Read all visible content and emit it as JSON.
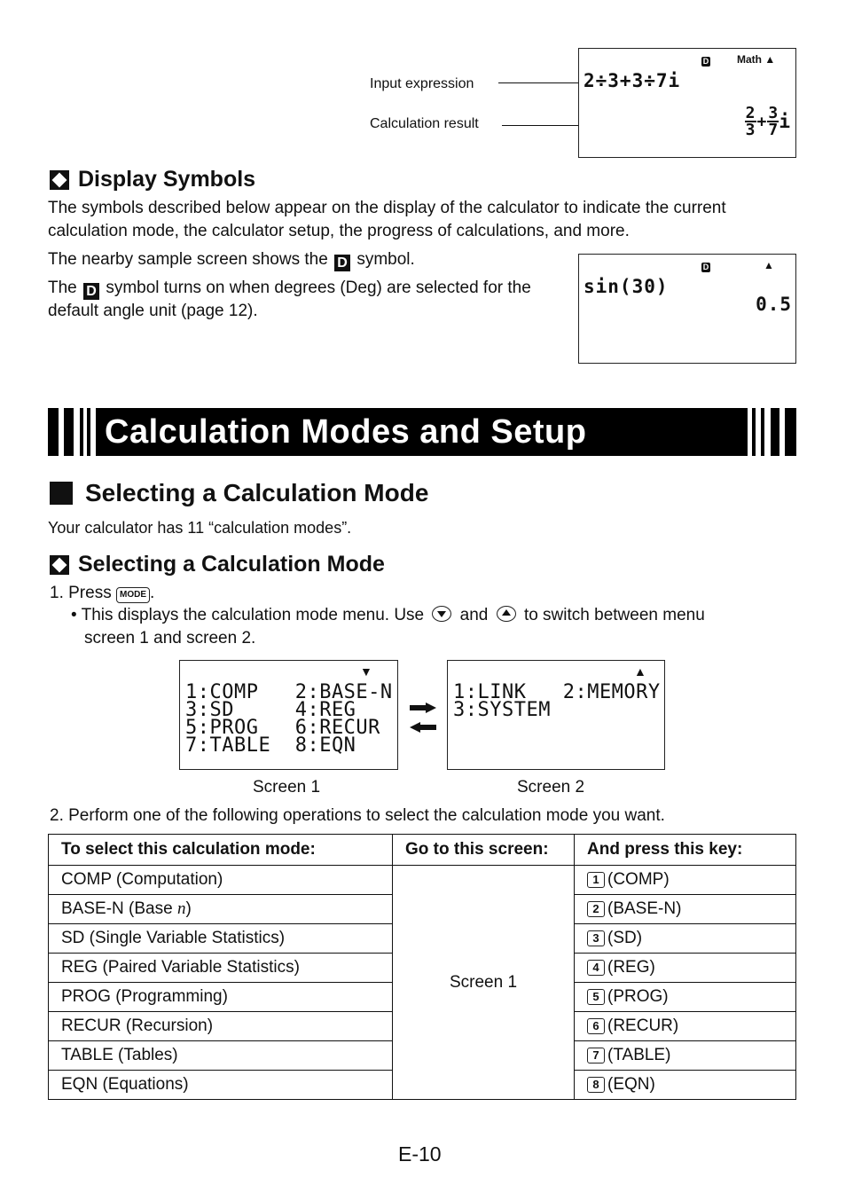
{
  "top_example": {
    "callout_input": "Input expression",
    "callout_result": "Calculation result",
    "screen": {
      "indicator_d": "D",
      "indicator_math": "Math",
      "indicator_arrow": "▲",
      "input_line": "2÷3+3÷7i",
      "result": {
        "frac1_num": "2",
        "frac1_den": "3",
        "plus": "+",
        "frac2_num": "3",
        "frac2_den": "7",
        "imag": "i"
      }
    }
  },
  "display_symbols": {
    "heading": "Display Symbols",
    "para1": "The symbols described below appear on the display of the calculator to indicate the current calculation mode, the calculator setup, the progress of calculations, and more.",
    "para2_before": "The nearby sample screen shows the",
    "para2_after": "symbol.",
    "para3_before": "The",
    "para3_after": "symbol turns on when degrees (Deg) are selected for the default angle unit (page 12).",
    "symbol": "D",
    "sample_screen": {
      "indicator_d": "D",
      "indicator_arrow": "▲",
      "input_line": "sin(30)",
      "result": "0.5"
    }
  },
  "banner": {
    "title": "Calculation Modes and Setup"
  },
  "section": {
    "heading": "Selecting a Calculation Mode",
    "intro": "Your calculator has 11 “calculation modes”.",
    "subheading": "Selecting a Calculation Mode",
    "step1_prefix": "1.  Press",
    "step1_key": "MODE",
    "step1_suffix": ".",
    "bullet_before": "• This displays the calculation mode menu. Use",
    "bullet_and": "and",
    "bullet_after": "to switch between menu",
    "bullet_line2": "screen 1 and screen 2.",
    "step2": "2.  Perform one of the following operations to select the calculation mode you want."
  },
  "screens": {
    "screen1": {
      "label": "Screen 1",
      "arrow": "▼",
      "lines": [
        "1:COMP   2:BASE-N",
        "3:SD     4:REG",
        "5:PROG   6:RECUR",
        "7:TABLE  8:EQN"
      ]
    },
    "screen2": {
      "label": "Screen 2",
      "arrow": "▲",
      "lines": [
        "1:LINK   2:MEMORY",
        "3:SYSTEM"
      ]
    }
  },
  "table": {
    "headers": [
      "To select this calculation mode:",
      "Go to this screen:",
      "And press this key:"
    ],
    "screen": "Screen 1",
    "rows": [
      {
        "mode_prefix": "COMP (Computation)",
        "mode_italic": "",
        "mode_suffix": "",
        "key": "1",
        "key_label": "(COMP)"
      },
      {
        "mode_prefix": "BASE-N (Base ",
        "mode_italic": "n",
        "mode_suffix": ")",
        "key": "2",
        "key_label": "(BASE-N)"
      },
      {
        "mode_prefix": "SD (Single Variable Statistics)",
        "mode_italic": "",
        "mode_suffix": "",
        "key": "3",
        "key_label": "(SD)"
      },
      {
        "mode_prefix": "REG (Paired Variable Statistics)",
        "mode_italic": "",
        "mode_suffix": "",
        "key": "4",
        "key_label": "(REG)"
      },
      {
        "mode_prefix": "PROG (Programming)",
        "mode_italic": "",
        "mode_suffix": "",
        "key": "5",
        "key_label": "(PROG)"
      },
      {
        "mode_prefix": "RECUR (Recursion)",
        "mode_italic": "",
        "mode_suffix": "",
        "key": "6",
        "key_label": "(RECUR)"
      },
      {
        "mode_prefix": "TABLE (Tables)",
        "mode_italic": "",
        "mode_suffix": "",
        "key": "7",
        "key_label": "(TABLE)"
      },
      {
        "mode_prefix": "EQN (Equations)",
        "mode_italic": "",
        "mode_suffix": "",
        "key": "8",
        "key_label": "(EQN)"
      }
    ]
  },
  "footer": {
    "page_number": "E-10"
  }
}
